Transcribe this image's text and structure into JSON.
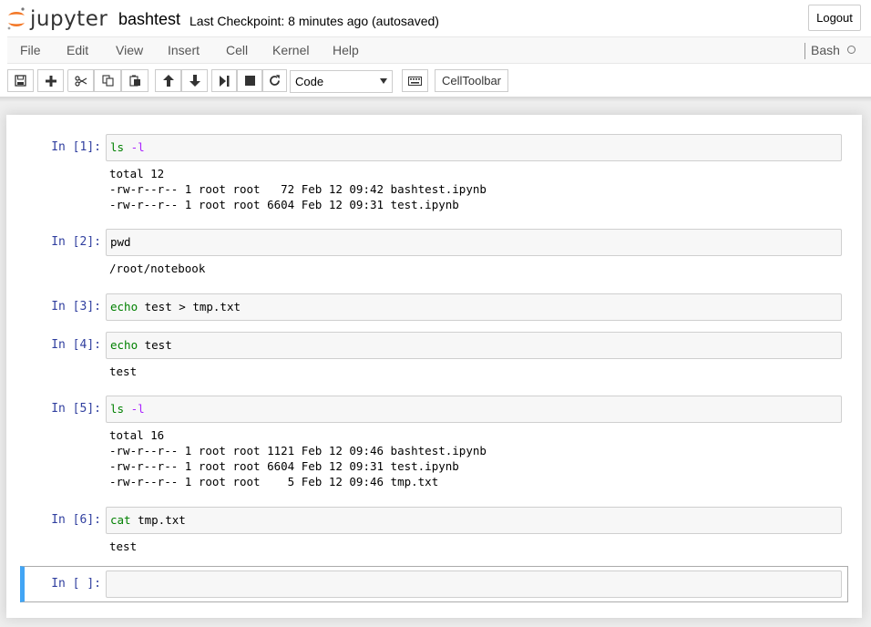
{
  "header": {
    "logo_text": "jupyter",
    "notebook_title": "bashtest",
    "checkpoint": "Last Checkpoint: 8 minutes ago (autosaved)",
    "logout_label": "Logout"
  },
  "menu": {
    "items": [
      "File",
      "Edit",
      "View",
      "Insert",
      "Cell",
      "Kernel",
      "Help"
    ],
    "kernel_name": "Bash"
  },
  "toolbar": {
    "cell_type": "Code",
    "celltoolbar_label": "CellToolbar"
  },
  "cells": [
    {
      "prompt": "In [1]:",
      "input_cmd": "ls",
      "input_rest": " -l",
      "output": "total 12\n-rw-r--r-- 1 root root   72 Feb 12 09:42 bashtest.ipynb\n-rw-r--r-- 1 root root 6604 Feb 12 09:31 test.ipynb"
    },
    {
      "prompt": "In [2]:",
      "input_cmd": "",
      "input_rest": "pwd",
      "output": "/root/notebook"
    },
    {
      "prompt": "In [3]:",
      "input_cmd": "echo",
      "input_rest": " test > tmp.txt",
      "output": ""
    },
    {
      "prompt": "In [4]:",
      "input_cmd": "echo",
      "input_rest": " test",
      "output": "test"
    },
    {
      "prompt": "In [5]:",
      "input_cmd": "ls",
      "input_rest": " -l",
      "output": "total 16\n-rw-r--r-- 1 root root 1121 Feb 12 09:46 bashtest.ipynb\n-rw-r--r-- 1 root root 6604 Feb 12 09:31 test.ipynb\n-rw-r--r-- 1 root root    5 Feb 12 09:46 tmp.txt"
    },
    {
      "prompt": "In [6]:",
      "input_cmd": "cat",
      "input_rest": " tmp.txt",
      "output": "test"
    },
    {
      "prompt": "In [ ]:",
      "input_cmd": "",
      "input_rest": "",
      "output": ""
    }
  ],
  "colors": {
    "prompt": "#303f9f",
    "keyword": "#008000",
    "selected_border": "#42a5f5",
    "logo_orange": "#f37726"
  }
}
